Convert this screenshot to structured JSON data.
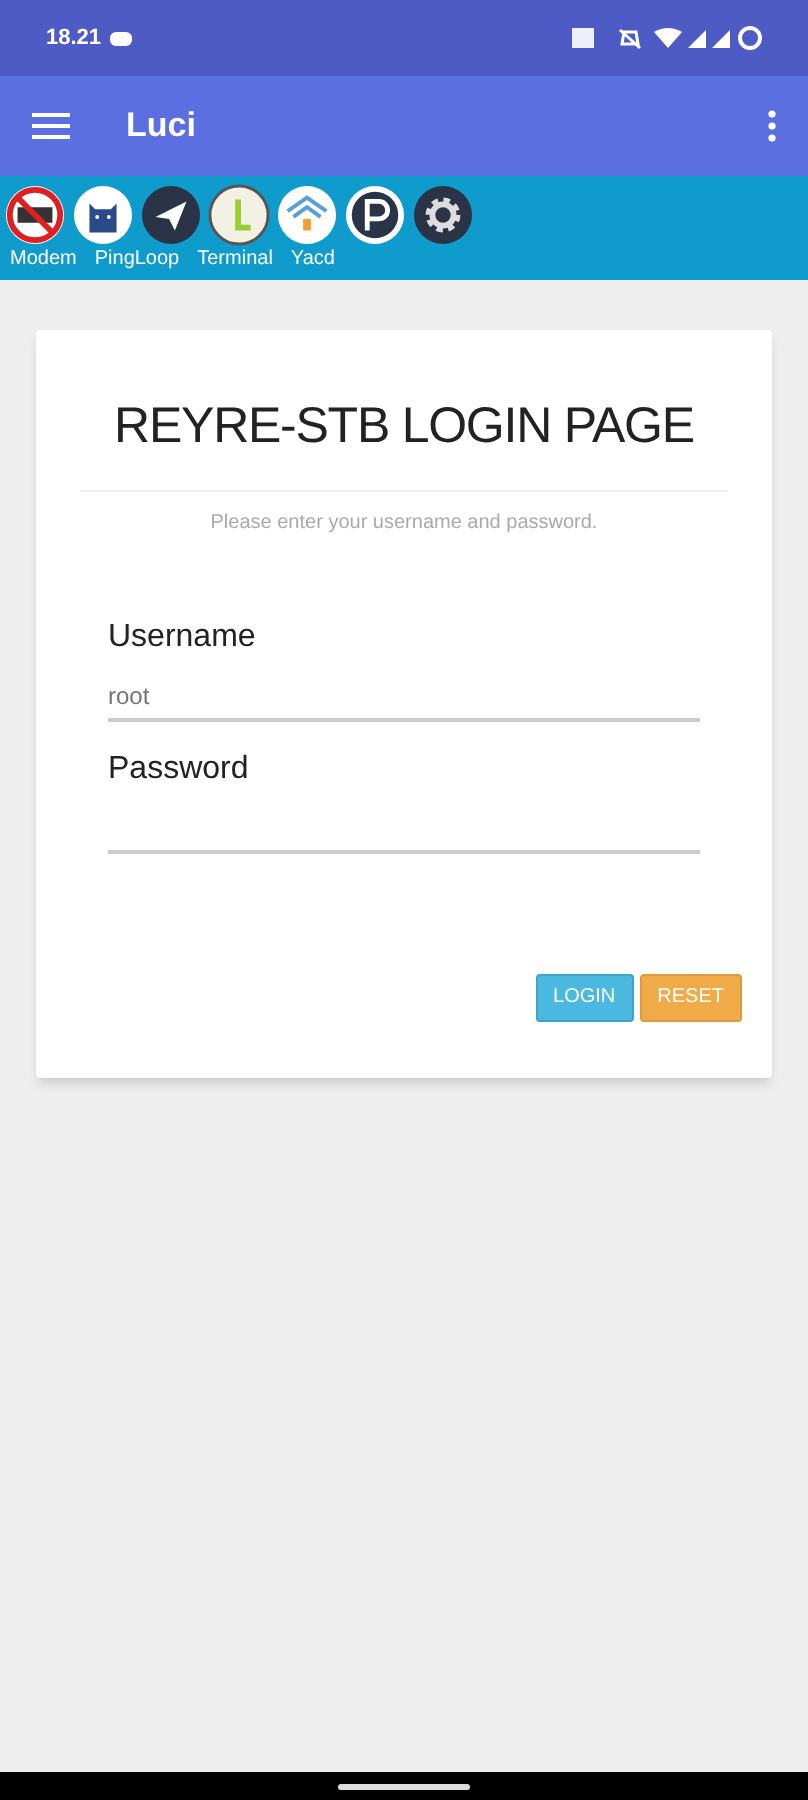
{
  "status_bar": {
    "time": "18.21"
  },
  "app_bar": {
    "title": "Luci"
  },
  "shortcuts": [
    {
      "kind": "no-ads"
    },
    {
      "kind": "cat"
    },
    {
      "kind": "plane"
    },
    {
      "kind": "bar"
    },
    {
      "kind": "network"
    },
    {
      "kind": "ring"
    },
    {
      "kind": "gear"
    }
  ],
  "shortcut_labels": [
    "Modem",
    "PingLoop",
    "Terminal",
    "Yacd"
  ],
  "login": {
    "title": "REYRE-STB LOGIN PAGE",
    "subtitle": "Please enter your username and password.",
    "fields": [
      {
        "label": "Username",
        "value": "root"
      },
      {
        "label": "Password"
      }
    ],
    "buttons": [
      {
        "label": "LOGIN",
        "kind": "primary"
      },
      {
        "label": "RESET",
        "kind": "warning"
      }
    ]
  }
}
